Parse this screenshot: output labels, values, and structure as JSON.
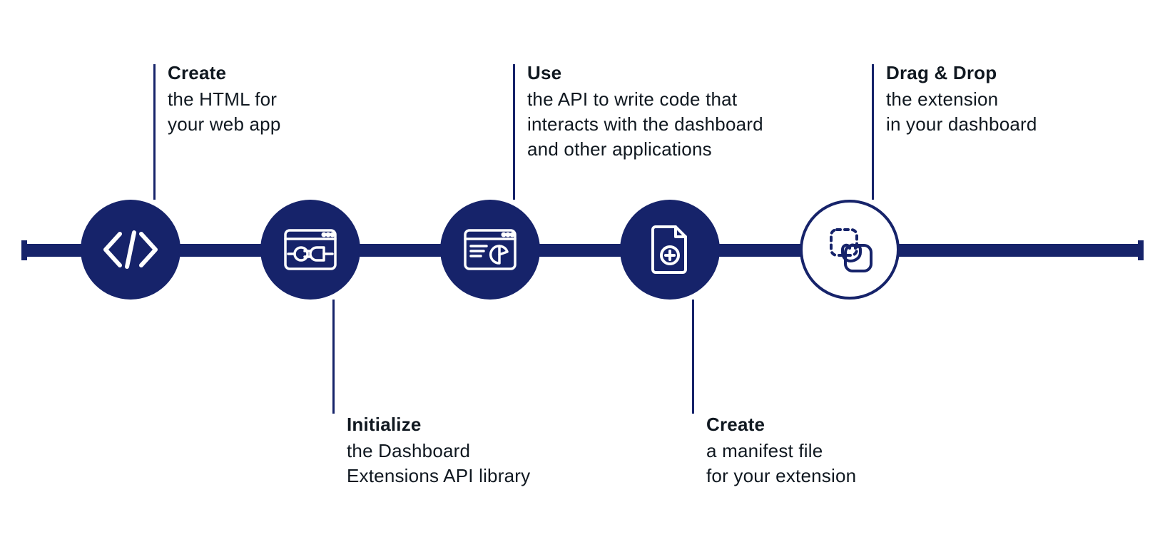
{
  "colors": {
    "primary": "#16236a",
    "text": "#101820",
    "bg": "#ffffff"
  },
  "steps": [
    {
      "id": "create-html",
      "icon": "code-icon",
      "title": "Create",
      "desc": "the HTML for\nyour web app"
    },
    {
      "id": "initialize",
      "icon": "plugin-icon",
      "title": "Initialize",
      "desc": "the Dashboard\nExtensions API library"
    },
    {
      "id": "use-api",
      "icon": "dashboard-icon",
      "title": "Use",
      "desc": "the API to write code that\ninteracts with the dashboard\nand other applications"
    },
    {
      "id": "create-manifest",
      "icon": "file-add-icon",
      "title": "Create",
      "desc": "a manifest file\nfor your extension"
    },
    {
      "id": "drag-drop",
      "icon": "drag-drop-icon",
      "title": "Drag & Drop",
      "desc": "the extension\nin your dashboard"
    }
  ]
}
